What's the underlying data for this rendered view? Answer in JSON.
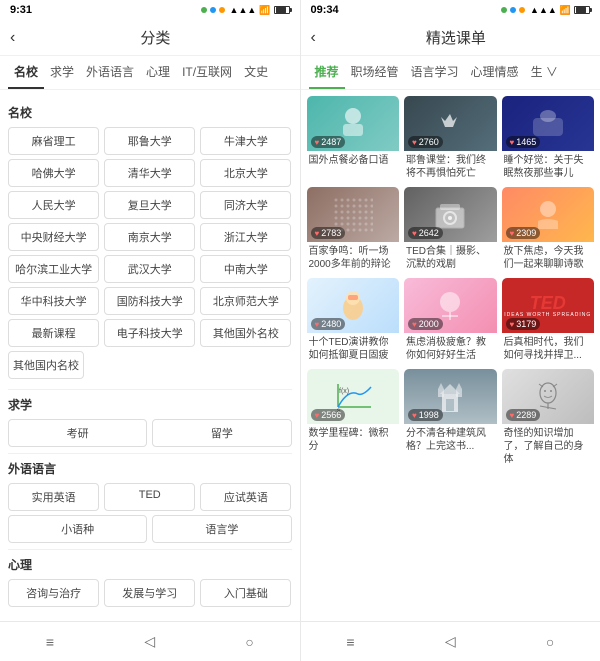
{
  "left": {
    "status": {
      "time": "9:31",
      "battery_level": "70"
    },
    "header": {
      "back": "‹",
      "title": "分类"
    },
    "category_tabs": [
      {
        "label": "名校",
        "active": true
      },
      {
        "label": "求学",
        "active": false
      },
      {
        "label": "外语语言",
        "active": false
      },
      {
        "label": "心理",
        "active": false
      },
      {
        "label": "IT/互联网",
        "active": false
      },
      {
        "label": "文史",
        "active": false
      }
    ],
    "sections": [
      {
        "title": "名校",
        "grid3": [
          [
            "麻省理工",
            "耶鲁大学",
            "牛津大学"
          ],
          [
            "哈佛大学",
            "清华大学",
            "北京大学"
          ],
          [
            "人民大学",
            "复旦大学",
            "同济大学"
          ],
          [
            "中央财经大学",
            "南京大学",
            "浙江大学"
          ],
          [
            "哈尔滨工业大学",
            "武汉大学",
            "中南大学"
          ],
          [
            "华中科技大学",
            "国防科技大学",
            "北京师范大学"
          ]
        ],
        "grid3_extra": [
          [
            "最新课程",
            "电子科技大学",
            "其他国外名校"
          ]
        ],
        "single": [
          "其他国内名校"
        ]
      },
      {
        "title": "求学",
        "grid2": [
          [
            "考研",
            "留学"
          ]
        ]
      },
      {
        "title": "外语语言",
        "grid3_foreign": [
          [
            "实用英语",
            "TED",
            "应试英语"
          ],
          [
            "小语种",
            "语言学"
          ]
        ]
      },
      {
        "title": "心理",
        "partial": [
          "咨询与治疗",
          "发展与学习",
          "入门基础"
        ]
      }
    ],
    "bottom_nav": [
      "≡",
      "◁",
      "○"
    ]
  },
  "right": {
    "status": {
      "time": "09:34"
    },
    "header": {
      "back": "‹",
      "title": "精选课单"
    },
    "tabs": [
      {
        "label": "推荐",
        "active": true
      },
      {
        "label": "职场经管",
        "active": false
      },
      {
        "label": "语言学习",
        "active": false
      },
      {
        "label": "心理情感",
        "active": false
      },
      {
        "label": "生",
        "active": false
      }
    ],
    "courses": [
      {
        "title": "国外点餐必备口语",
        "likes": "2487",
        "thumb_type": "teal",
        "thumb_label": "人物"
      },
      {
        "title": "耶鲁课堂：我们终将不再惧怕死亡",
        "likes": "2760",
        "thumb_type": "dark",
        "thumb_label": "鸟"
      },
      {
        "title": "睡个好觉：关于失眠熬夜那些事儿",
        "likes": "1465",
        "thumb_type": "navy",
        "thumb_label": "睡觉"
      },
      {
        "title": "百家争鸣：听一场2000多年前的辩论",
        "likes": "2783",
        "thumb_type": "brown",
        "thumb_label": "纹理"
      },
      {
        "title": "TED合集｜摄影、沉默的戏剧",
        "likes": "2642",
        "thumb_type": "gray",
        "thumb_label": "相机"
      },
      {
        "title": "放下焦虑，今天我们一起来聊聊诗歌",
        "likes": "2309",
        "thumb_type": "warm",
        "thumb_label": "茶"
      },
      {
        "title": "十个TED演讲教你如何抵御夏日固疲",
        "likes": "2480",
        "thumb_type": "light",
        "thumb_label": "卡通"
      },
      {
        "title": "焦虑消极疲惫？教你如何好好生活",
        "likes": "2000",
        "thumb_type": "pink",
        "thumb_label": "卡通人物"
      },
      {
        "title": "后真相时代，我们如何寻找并捍卫...",
        "likes": "3179",
        "thumb_type": "red",
        "thumb_label": "TED"
      },
      {
        "title": "数学里程碑：微积分",
        "likes": "2566",
        "thumb_type": "green",
        "thumb_label": "坐标轴"
      },
      {
        "title": "分不清各种建筑风格？上完这书...",
        "likes": "1998",
        "thumb_type": "bluegray",
        "thumb_label": "教堂"
      },
      {
        "title": "奇怪的知识增加了，了解自己的身体",
        "likes": "2289",
        "thumb_type": "yellow",
        "thumb_label": "解剖"
      }
    ],
    "bottom_nav": [
      "≡",
      "◁",
      "○"
    ]
  }
}
